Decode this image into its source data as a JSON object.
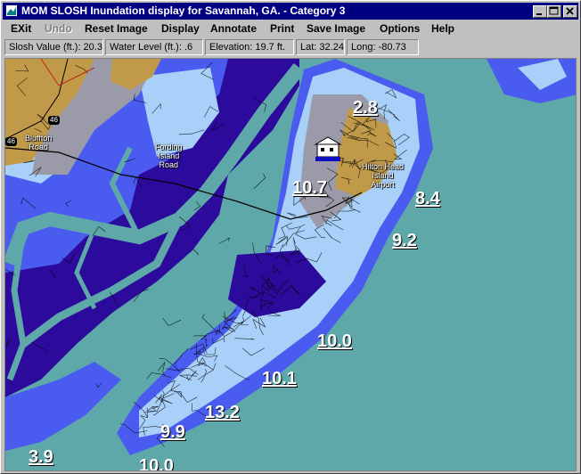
{
  "window": {
    "title": "MOM SLOSH Inundation display for Savannah, GA. - Category 3"
  },
  "menu": [
    {
      "label": "EXit",
      "enabled": true
    },
    {
      "label": "Undo",
      "enabled": false
    },
    {
      "label": "Reset Image",
      "enabled": true
    },
    {
      "label": "Display",
      "enabled": true
    },
    {
      "label": "Annotate",
      "enabled": true
    },
    {
      "label": "Print",
      "enabled": true
    },
    {
      "label": "Save Image",
      "enabled": true
    },
    {
      "label": "Options",
      "enabled": true
    },
    {
      "label": "Help",
      "enabled": true
    }
  ],
  "status": {
    "slosh": "Slosh Value (ft.): 20.3",
    "water": "Water Level (ft.): .6",
    "elevation": "Elevation: 19.7 ft.",
    "lat": "Lat: 32.24",
    "long": "Long: -80.73"
  },
  "map": {
    "places": {
      "bluffton": "Bluffton\nRoad",
      "fording": "Fording\nIsland\nRoad",
      "airport": "Hilton Head\nIsland\nAirport"
    },
    "shields": {
      "s46a": "46",
      "s46b": "46"
    },
    "values": {
      "v1": "2.8",
      "v2": "10.7",
      "v3": "8.4",
      "v4": "9.2",
      "v5": "10.0",
      "v6": "10.1",
      "v7": "13.2",
      "v8": "9.9",
      "v9": "3.9",
      "v10": "10.0"
    },
    "colors": {
      "water": "#5fa8aa",
      "deep": "#2c0a9c",
      "mid": "#4a5cf0",
      "light": "#a8d0f8",
      "land": "#c09a48"
    }
  }
}
